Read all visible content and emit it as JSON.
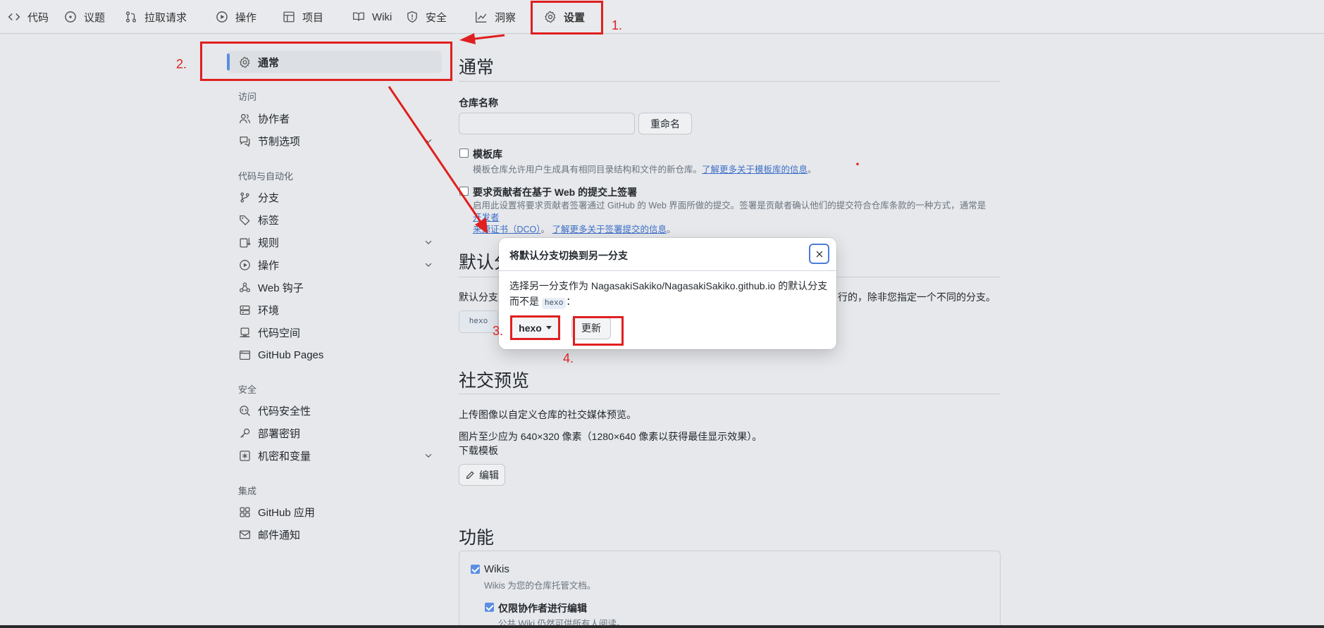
{
  "nav": {
    "tabs": [
      {
        "label": "代码",
        "icon": "code-icon"
      },
      {
        "label": "议题",
        "icon": "issue-icon"
      },
      {
        "label": "拉取请求",
        "icon": "pull-request-icon"
      },
      {
        "label": "操作",
        "icon": "play-icon"
      },
      {
        "label": "项目",
        "icon": "table-icon"
      },
      {
        "label": "Wiki",
        "icon": "book-icon"
      },
      {
        "label": "安全",
        "icon": "shield-icon"
      },
      {
        "label": "洞察",
        "icon": "graph-icon"
      },
      {
        "label": "设置",
        "icon": "gear-icon",
        "selected": true
      }
    ]
  },
  "sidebar": {
    "general": "通常",
    "sections": [
      {
        "heading": "访问",
        "items": [
          {
            "label": "协作者",
            "icon": "people-icon"
          },
          {
            "label": "节制选项",
            "icon": "comment-icon",
            "expandable": true
          }
        ]
      },
      {
        "heading": "代码与自动化",
        "items": [
          {
            "label": "分支",
            "icon": "branch-icon"
          },
          {
            "label": "标签",
            "icon": "tag-icon"
          },
          {
            "label": "规则",
            "icon": "rules-icon",
            "expandable": true
          },
          {
            "label": "操作",
            "icon": "play-icon",
            "expandable": true
          },
          {
            "label": "Web 钩子",
            "icon": "webhook-icon"
          },
          {
            "label": "环境",
            "icon": "server-icon"
          },
          {
            "label": "代码空间",
            "icon": "codespaces-icon"
          },
          {
            "label": "GitHub Pages",
            "icon": "browser-icon"
          }
        ]
      },
      {
        "heading": "安全",
        "items": [
          {
            "label": "代码安全性",
            "icon": "codescan-icon"
          },
          {
            "label": "部署密钥",
            "icon": "key-icon"
          },
          {
            "label": "机密和变量",
            "icon": "asterisk-icon",
            "expandable": true
          }
        ]
      },
      {
        "heading": "集成",
        "items": [
          {
            "label": "GitHub 应用",
            "icon": "apps-icon"
          },
          {
            "label": "邮件通知",
            "icon": "mail-icon"
          }
        ]
      }
    ]
  },
  "main": {
    "general_title": "通常",
    "repo_name_label": "仓库名称",
    "repo_name_value": "",
    "rename_button": "重命名",
    "template": {
      "label": "模板库",
      "desc": "模板仓库允许用户生成具有相同目录结构和文件的新仓库。",
      "link": "了解更多关于模板库的信息",
      "tail": "。",
      "checked": false
    },
    "signoff": {
      "label": "要求贡献者在基于 Web 的提交上签署",
      "desc": "启用此设置将要求贡献者签署通过 GitHub 的 Web 界面所做的提交。签署是贡献者确认他们的提交符合仓库条款的一种方式，通常是",
      "link1": "开发者",
      "link1b": "来源证书（DCO）",
      "sep": "。",
      "link2": "了解更多关于签署提交的信息",
      "tail": "。",
      "checked": false
    },
    "default_branch_title": "默认分",
    "default_branch_desc_start": "默认分支",
    "default_branch_desc_end": "行的，除非您指定一个不同的分支。",
    "default_branch_chip": "hexo",
    "social_title": "社交预览",
    "social_desc": "上传图像以自定义仓库的社交媒体预览。",
    "social_size": "图片至少应为 640×320 像素（1280×640 像素以获得最佳显示效果）。",
    "social_template_link": "下载模板",
    "edit_button": "编辑",
    "features_title": "功能",
    "wikis_label": "Wikis",
    "wikis_desc": "Wikis 为您的仓库托管文档。",
    "wikis_checked": true,
    "restrict_label": "仅限协作者进行编辑",
    "restrict_desc": "公共 Wiki 仍然可供所有人阅读。",
    "restrict_checked": true
  },
  "dialog": {
    "title": "将默认分支切换到另一分支",
    "body_start": "选择另一分支作为 NagasakiSakiko/NagasakiSakiko.github.io 的默认分支",
    "body_mid": "而不是",
    "body_chip": "hexo",
    "body_end": "：",
    "branch_select": "hexo",
    "update_button": "更新"
  },
  "annotations": {
    "labels": [
      "1.",
      "2.",
      "3.",
      "4."
    ],
    "color": "#e01f1f"
  }
}
